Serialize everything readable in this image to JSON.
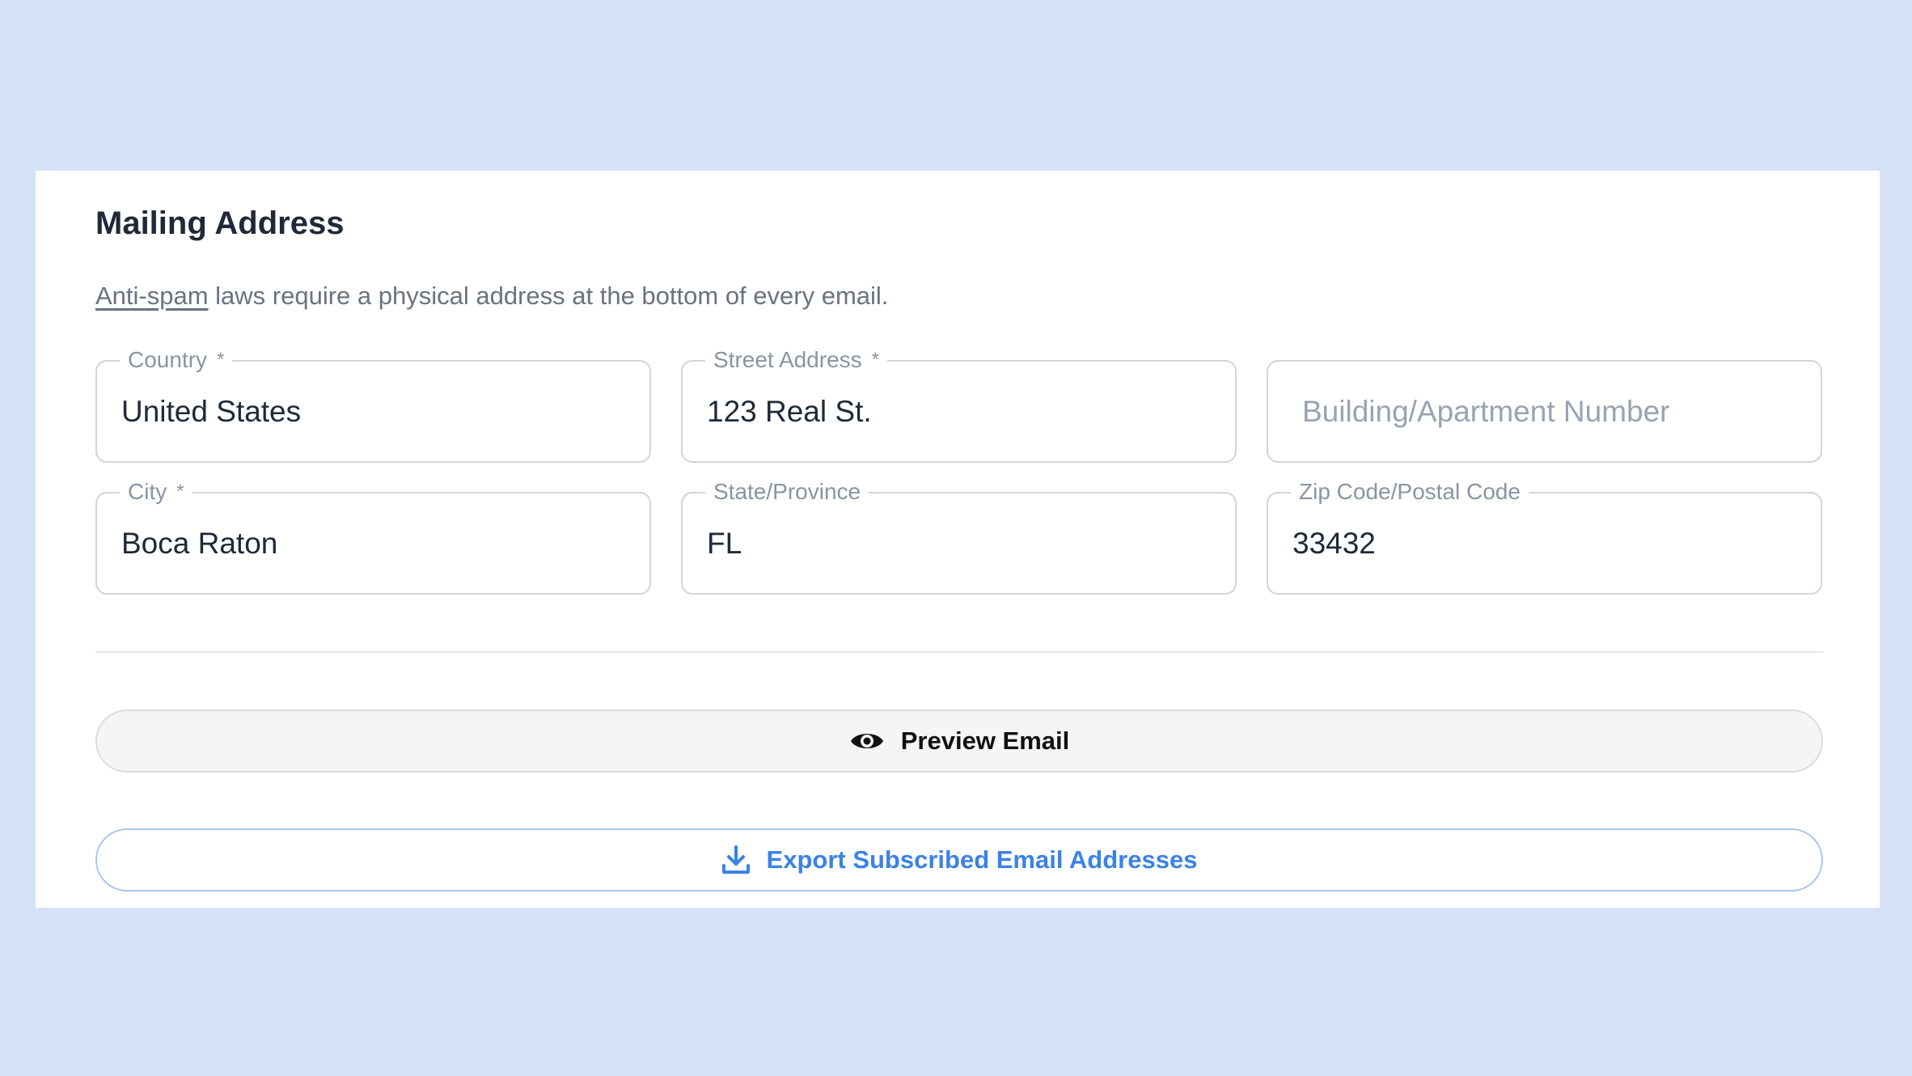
{
  "section": {
    "title": "Mailing Address",
    "description_link": "Anti-spam",
    "description_rest": " laws require a physical address at the bottom of every email."
  },
  "fields": {
    "country": {
      "label": "Country",
      "required_mark": "*",
      "value": "United States"
    },
    "street": {
      "label": "Street Address",
      "required_mark": "*",
      "value": "123 Real St."
    },
    "building": {
      "placeholder": "Building/Apartment Number",
      "value": ""
    },
    "city": {
      "label": "City",
      "required_mark": "*",
      "value": "Boca Raton"
    },
    "state": {
      "label": "State/Province",
      "value": "FL"
    },
    "zip": {
      "label": "Zip Code/Postal Code",
      "value": "33432"
    }
  },
  "buttons": {
    "preview": {
      "label": "Preview Email",
      "icon": "eye-icon"
    },
    "export": {
      "label": "Export Subscribed Email Addresses",
      "icon": "download-icon"
    }
  },
  "colors": {
    "page_background": "#d4e2f8",
    "card_background": "#ffffff",
    "accent": "#3b82e6",
    "field_border": "#d1d5db"
  }
}
